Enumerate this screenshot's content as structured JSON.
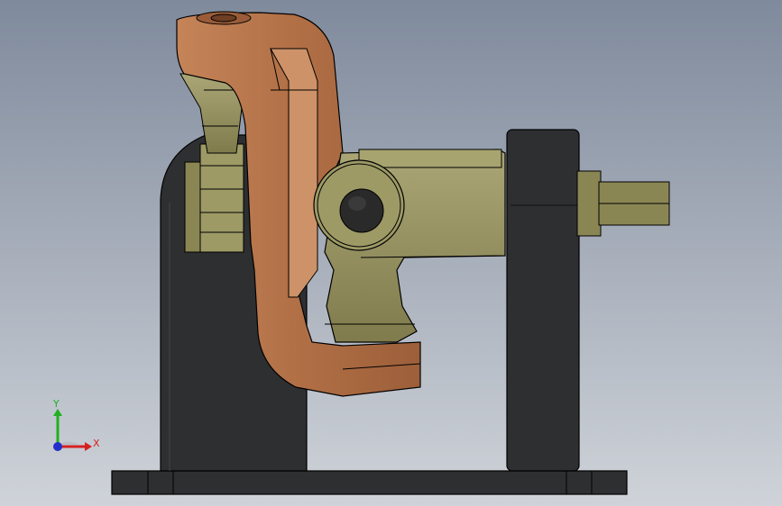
{
  "viewport": {
    "background_top": "#7f8a9c",
    "background_bottom": "#cfd3d9"
  },
  "colors": {
    "base_dark": "#2e2f30",
    "bronze": "#b6744c",
    "bronze_light": "#d09a72",
    "olive": "#8a8654",
    "olive_light": "#b7b482",
    "outline": "#000000"
  },
  "triad": {
    "x_label": "X",
    "y_label": "Y",
    "x_color": "#d62020",
    "y_color": "#20b020",
    "z_color": "#2030c8"
  }
}
